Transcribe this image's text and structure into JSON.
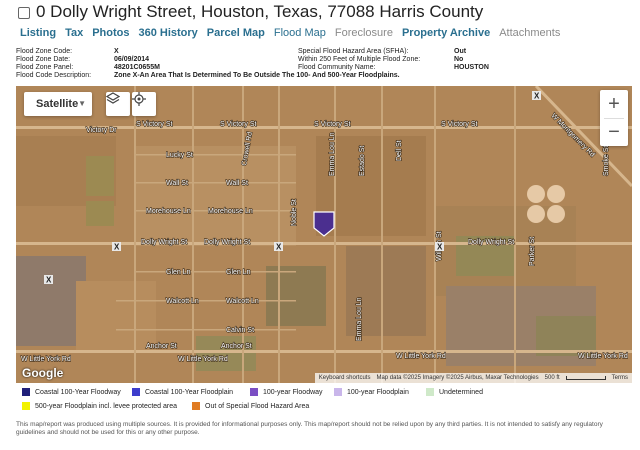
{
  "header": {
    "title": "0 Dolly Wright Street, Houston, Texas, 77088 Harris County"
  },
  "tabs": [
    {
      "label": "Listing",
      "state": "normal"
    },
    {
      "label": "Tax",
      "state": "normal"
    },
    {
      "label": "Photos",
      "state": "normal"
    },
    {
      "label": "360 History",
      "state": "normal"
    },
    {
      "label": "Parcel Map",
      "state": "normal"
    },
    {
      "label": "Flood Map",
      "state": "active"
    },
    {
      "label": "Foreclosure",
      "state": "muted"
    },
    {
      "label": "Property Archive",
      "state": "normal"
    },
    {
      "label": "Attachments",
      "state": "muted"
    }
  ],
  "flood_info": {
    "zone_code_label": "Flood Zone Code:",
    "zone_code": "X",
    "zone_date_label": "Flood Zone Date:",
    "zone_date": "06/09/2014",
    "zone_panel_label": "Flood Zone Panel:",
    "zone_panel": "48201C0655M",
    "zone_desc_label": "Flood Code Description:",
    "zone_desc": "Zone X-An Area That Is Determined To Be Outside The 100- And 500-Year Floodplains.",
    "sfha_label": "Special Flood Hazard Area (SFHA):",
    "sfha": "Out",
    "within250_label": "Within 250 Feet of Multiple Flood Zone:",
    "within250": "No",
    "community_label": "Flood Community Name:",
    "community": "HOUSTON"
  },
  "map": {
    "map_type": "Satellite",
    "zoom_in": "+",
    "zoom_out": "−",
    "google_logo": "Google",
    "keyboard_shortcuts": "Keyboard shortcuts",
    "attribution": "Map data ©2025 Imagery ©2025 Airbus, Maxar Technologies",
    "scale": "500 ft",
    "terms": "Terms",
    "zone_x_marker": "X",
    "streets": {
      "victory_dr": "Victory Dr",
      "s_victory_st": "S Victory St",
      "w_montgomery_rd": "W Montgomery Rd",
      "lucky_st": "Lucky St",
      "wall_st": "Wall St",
      "morehouse_ln": "Morehouse Ln",
      "dolly_wright_st": "Dolly Wright St",
      "glen_ln": "Glen Ln",
      "walcott_ln": "Walcott Ln",
      "calvin_st": "Calvin St",
      "anchor_st": "Anchor St",
      "w_little_york_rd": "W Little York Rd",
      "wilson_st": "Wilson St",
      "parker_st": "Parker St",
      "crowell_rd": "Crowell Rd",
      "emma_lou_ln": "Emma Lou Ln",
      "noble_st": "Noble St",
      "dell_st": "Dell St",
      "estado_st": "Estado St",
      "smoke_st": "Smoke St"
    },
    "colors": {
      "zone_x_tint": "#b38a5a",
      "pin": "#4b2f8f"
    }
  },
  "legend": [
    {
      "label": "Coastal 100-Year Floodway",
      "color": "#1f1f7a"
    },
    {
      "label": "Coastal 100-Year Floodplain",
      "color": "#3d3dcc"
    },
    {
      "label": "100-year Floodway",
      "color": "#7b4fc4"
    },
    {
      "label": "100-year Floodplain",
      "color": "#c9b6ea"
    },
    {
      "label": "Undetermined",
      "color": "#cfe9c9"
    },
    {
      "label": "500-year Floodplain incl. levee protected area",
      "color": "#f2f200"
    },
    {
      "label": "Out of Special Flood Hazard Area",
      "color": "#e07b22"
    }
  ],
  "disclaimer": "This map/report was produced using multiple sources. It is provided for informational purposes only. This map/report should not be relied upon by any third parties. It is not intended to satisfy any regulatory guidelines and should not be used for this or any other purpose."
}
